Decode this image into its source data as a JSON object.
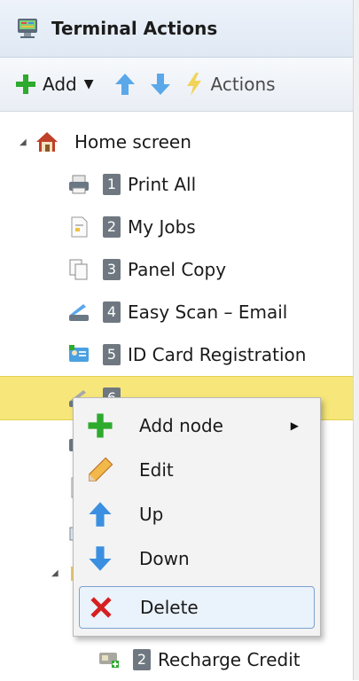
{
  "panel": {
    "title": "Terminal Actions"
  },
  "toolbar": {
    "add_label": "Add",
    "actions_label": "Actions"
  },
  "tree": {
    "root": {
      "label": "Home screen"
    },
    "items": [
      {
        "num": "1",
        "label": "Print All",
        "icon": "printer-icon"
      },
      {
        "num": "2",
        "label": "My Jobs",
        "icon": "document-icon"
      },
      {
        "num": "3",
        "label": "Panel Copy",
        "icon": "copy-icon"
      },
      {
        "num": "4",
        "label": "Easy Scan – Email",
        "icon": "scanner-icon"
      },
      {
        "num": "5",
        "label": "ID Card Registration",
        "icon": "id-card-icon"
      },
      {
        "num": "6",
        "label": "",
        "icon": "scan-folder-icon"
      }
    ],
    "bottom_item": {
      "num": "2",
      "label": "Recharge Credit",
      "icon": "recharge-icon"
    }
  },
  "context_menu": {
    "items": [
      {
        "label": "Add node",
        "icon": "plus-icon",
        "submenu": true
      },
      {
        "label": "Edit",
        "icon": "pencil-icon"
      },
      {
        "label": "Up",
        "icon": "arrow-up-icon"
      },
      {
        "label": "Down",
        "icon": "arrow-down-icon"
      },
      {
        "label": "Delete",
        "icon": "delete-x-icon",
        "highlighted": true
      }
    ]
  },
  "colors": {
    "selection": "#f7e77a",
    "badge": "#6f7880",
    "add_green": "#2eaa2e",
    "arrow_blue": "#3b8fe0",
    "delete_red": "#d62020"
  }
}
